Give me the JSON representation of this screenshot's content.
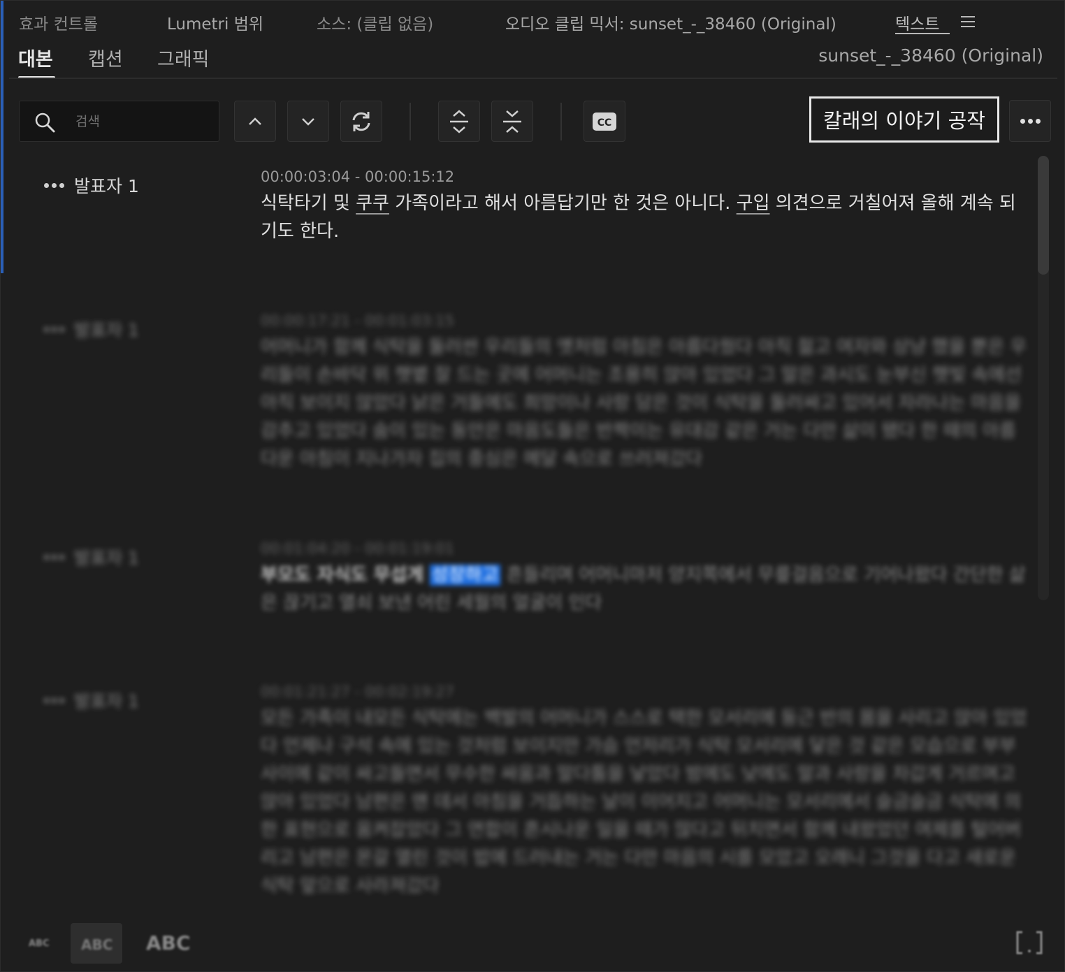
{
  "panel_tabs": [
    {
      "label": "효과 컨트롤"
    },
    {
      "label": "Lumetri 범위"
    },
    {
      "label": "소스: (클립 없음)"
    },
    {
      "label": "오디오 클립 믹서: sunset_-_38460 (Original)"
    },
    {
      "label": "텍스트"
    }
  ],
  "sub_tabs": [
    {
      "label": "대본"
    },
    {
      "label": "캡션"
    },
    {
      "label": "그래픽"
    }
  ],
  "clip_name": "sunset_-_38460 (Original)",
  "search": {
    "placeholder": "검색",
    "value": ""
  },
  "font_preview": "칼래의 이야기 공작",
  "colors": {
    "accent": "#2a5fb7",
    "highlight": "#1f6fe0",
    "background": "#1e1e1e"
  },
  "icons": [
    "search-icon",
    "chevron-up-icon",
    "chevron-down-icon",
    "refresh-icon",
    "expand-icon",
    "collapse-icon",
    "closed-caption-icon",
    "more-icon",
    "bracket-icon"
  ],
  "cc_label": "CC",
  "segments": [
    {
      "speaker": "발표자 1",
      "timecode": "00:00:03:04 - 00:00:15:12",
      "text_parts": [
        "식탁타기 및 ",
        "쿠쿠",
        " 가족이라고 해서 아름답기만 한 것은 아니다. ",
        "구입",
        " 의견으로 거칠어져 올해 계속 되기도 한다."
      ]
    },
    {
      "speaker": "발표자 1",
      "timecode": "00:00:17:21 - 00:01:03:15",
      "text": "어머니가 함께 식탁을 둘러싼 우리들의 옛처럼 아침은 아름다웠다 아직 젊고 여자와 상냥 했을 뿐은 우리들이 손바닥 위 햇볕 잘 드는 곳에 어머니는 조용히 앉아 있었다 그 말은 과시도 눈부신 햇빛 속에선 아직 보이지 않았다 낡은 거들에도 희망이나 사랑 담은 것이 식탁을 둘러싸고 있어서 자라나는 마음을 감추고 있었다 숨이 있는 동안은 마음도들은 반짝이는 유대감 같은 거는 다만 삶이 됐다 한 때의 아름다운 아침이 지나가자 집의 중심은 메달 속으로 쓰러져갔다"
    },
    {
      "speaker": "발표자 1",
      "timecode": "00:01:04:20 - 00:01:19:01",
      "bold": "부모도 자식도 무섭게",
      "highlight": "성장하고",
      "rest": " 흔들리며 어머니마저 양지쪽에서 무릎걸음으로 기어나왔다 간단한 삶은 끊기고 열쇠 보낸 어린 세월의 얼굴이 인다"
    },
    {
      "speaker": "발표자 1",
      "timecode": "00:01:21:27 - 00:02:19:27",
      "text": "모든 가족이 내모든 식탁에는 백발의 어머니가 스스로 택한 모서리에 둥근 반의 몸을 사리고 앉아 있었다 언제나 구석 속에 있는 것처럼 보이지만 가슴 언저리가 식탁 모서리에 닿은 것 같은 모습으로 부부 사이에 같이 싸고들면서 무수한 싸움과 말다툼을 낳았다 밤에도 낮에도 말과 사랑을 차갑게 거르며고 앉아 있었다 남편은 맨 데서 아침을 거듭하는 날이 이어지고 어머니는 모서리에서 슬금슬금 식탁에 의한 표현으로 움켜잡았다 그 연합이 흔시나운 일을 때가 많다고 뒤치면서 함께 내왔었던 여제를 털어버리고 남편은 몬갈 열린 것이 밥에 드러내는 거는 다만 마음의 시를 모았고 오래니 그것을 다고 새로운 식탁 앞으로 사라져갔다"
    }
  ],
  "bottom_bar": {
    "abc_small": "ABC",
    "abc_medium": "ABC",
    "abc_large": "ABC"
  }
}
